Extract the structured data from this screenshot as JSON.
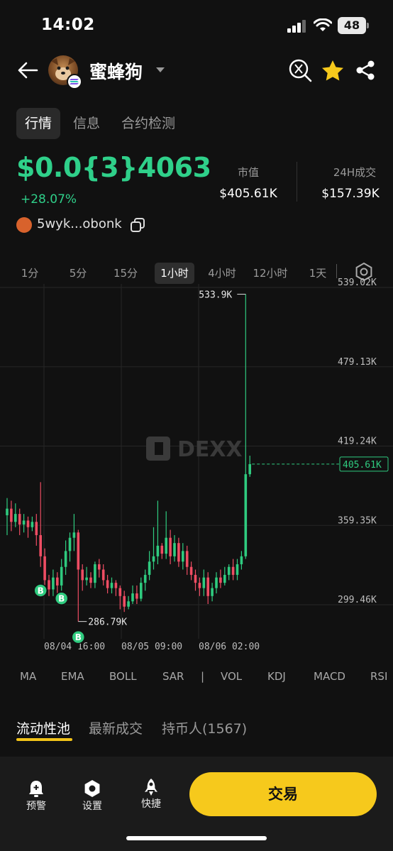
{
  "status_bar": {
    "time": "14:02",
    "battery": "48"
  },
  "header": {
    "token_name": "蜜蜂狗"
  },
  "tabs": [
    "行情",
    "信息",
    "合约检测"
  ],
  "price": {
    "value": "$0.0{3}4063",
    "change": "+28.07%"
  },
  "stats": [
    {
      "label": "市值",
      "value": "$405.61K"
    },
    {
      "label": "24H成交",
      "value": "$157.39K"
    }
  ],
  "creator": {
    "address": "5wyk...obonk"
  },
  "intervals": [
    "1分",
    "5分",
    "15分",
    "1小时",
    "4小时",
    "12小时",
    "1天"
  ],
  "active_interval": "1小时",
  "chart": {
    "watermark": "DEXX",
    "y_ticks": [
      "539.02K",
      "479.13K",
      "419.24K",
      "359.35K",
      "299.46K"
    ],
    "x_ticks": [
      "08/04 16:00",
      "08/05 09:00",
      "08/06 02:00"
    ],
    "high_label": "533.9K",
    "low_label": "286.79K",
    "current_label": "405.61K",
    "buy_marker": "B",
    "colors": {
      "up": "#2fcb7f",
      "down": "#ee4d63",
      "grid": "#262626"
    }
  },
  "chart_data": {
    "type": "candlestick",
    "x_labels": [
      "08/04 16:00",
      "08/05 09:00",
      "08/06 02:00"
    ],
    "y_ticks": [
      539.02,
      479.13,
      419.24,
      359.35,
      299.46
    ],
    "ylim": [
      260,
      545
    ],
    "unit": "K",
    "high": 533.9,
    "low": 286.79,
    "last": 405.61,
    "candles": [
      [
        367,
        372,
        352,
        380
      ],
      [
        372,
        362,
        355,
        378
      ],
      [
        362,
        368,
        358,
        376
      ],
      [
        368,
        360,
        352,
        372
      ],
      [
        360,
        363,
        354,
        368
      ],
      [
        363,
        358,
        350,
        366
      ],
      [
        358,
        362,
        355,
        366
      ],
      [
        362,
        352,
        344,
        368
      ],
      [
        352,
        336,
        328,
        392
      ],
      [
        336,
        318,
        310,
        342
      ],
      [
        318,
        311,
        306,
        322
      ],
      [
        311,
        320,
        306,
        326
      ],
      [
        320,
        314,
        308,
        324
      ],
      [
        314,
        328,
        310,
        334
      ],
      [
        328,
        340,
        322,
        348
      ],
      [
        340,
        350,
        332,
        354
      ],
      [
        350,
        354,
        340,
        368
      ],
      [
        354,
        326,
        286.79,
        356
      ],
      [
        326,
        318,
        310,
        330
      ],
      [
        318,
        320,
        314,
        328
      ],
      [
        320,
        316,
        312,
        324
      ],
      [
        316,
        330,
        312,
        332
      ],
      [
        330,
        326,
        320,
        334
      ],
      [
        326,
        318,
        314,
        330
      ],
      [
        318,
        312,
        308,
        322
      ],
      [
        312,
        316,
        308,
        320
      ],
      [
        316,
        312,
        306,
        318
      ],
      [
        312,
        306,
        296,
        314
      ],
      [
        306,
        298,
        294,
        310
      ],
      [
        298,
        302,
        296,
        306
      ],
      [
        302,
        308,
        300,
        314
      ],
      [
        308,
        304,
        300,
        314
      ],
      [
        304,
        316,
        302,
        320
      ],
      [
        316,
        322,
        310,
        326
      ],
      [
        322,
        332,
        318,
        340
      ],
      [
        332,
        336,
        326,
        358
      ],
      [
        336,
        344,
        330,
        378
      ],
      [
        344,
        338,
        334,
        346
      ],
      [
        338,
        350,
        334,
        370
      ],
      [
        350,
        336,
        330,
        356
      ],
      [
        336,
        346,
        332,
        352
      ],
      [
        346,
        332,
        328,
        350
      ],
      [
        332,
        340,
        326,
        346
      ],
      [
        340,
        328,
        322,
        344
      ],
      [
        328,
        322,
        318,
        332
      ],
      [
        322,
        316,
        310,
        326
      ],
      [
        316,
        312,
        306,
        320
      ],
      [
        312,
        320,
        306,
        326
      ],
      [
        320,
        306,
        300,
        324
      ],
      [
        306,
        312,
        302,
        316
      ],
      [
        312,
        320,
        308,
        324
      ],
      [
        320,
        316,
        312,
        326
      ],
      [
        316,
        322,
        314,
        328
      ],
      [
        322,
        328,
        318,
        330
      ],
      [
        328,
        322,
        318,
        334
      ],
      [
        322,
        330,
        318,
        334
      ],
      [
        330,
        336,
        326,
        340
      ],
      [
        336,
        398,
        334,
        533.9
      ],
      [
        398,
        405.61,
        396,
        412
      ]
    ],
    "buys": [
      [
        8,
        322
      ],
      [
        13,
        316
      ],
      [
        17,
        286.79
      ]
    ]
  },
  "indicators": [
    "MA",
    "EMA",
    "BOLL",
    "SAR",
    "|",
    "VOL",
    "KDJ",
    "MACD",
    "RSI"
  ],
  "bottom_tabs": [
    "流动性池",
    "最新成交",
    "持币人(1567)"
  ],
  "footer": {
    "alert": "预警",
    "settings": "设置",
    "quick": "快捷",
    "trade": "交易"
  }
}
